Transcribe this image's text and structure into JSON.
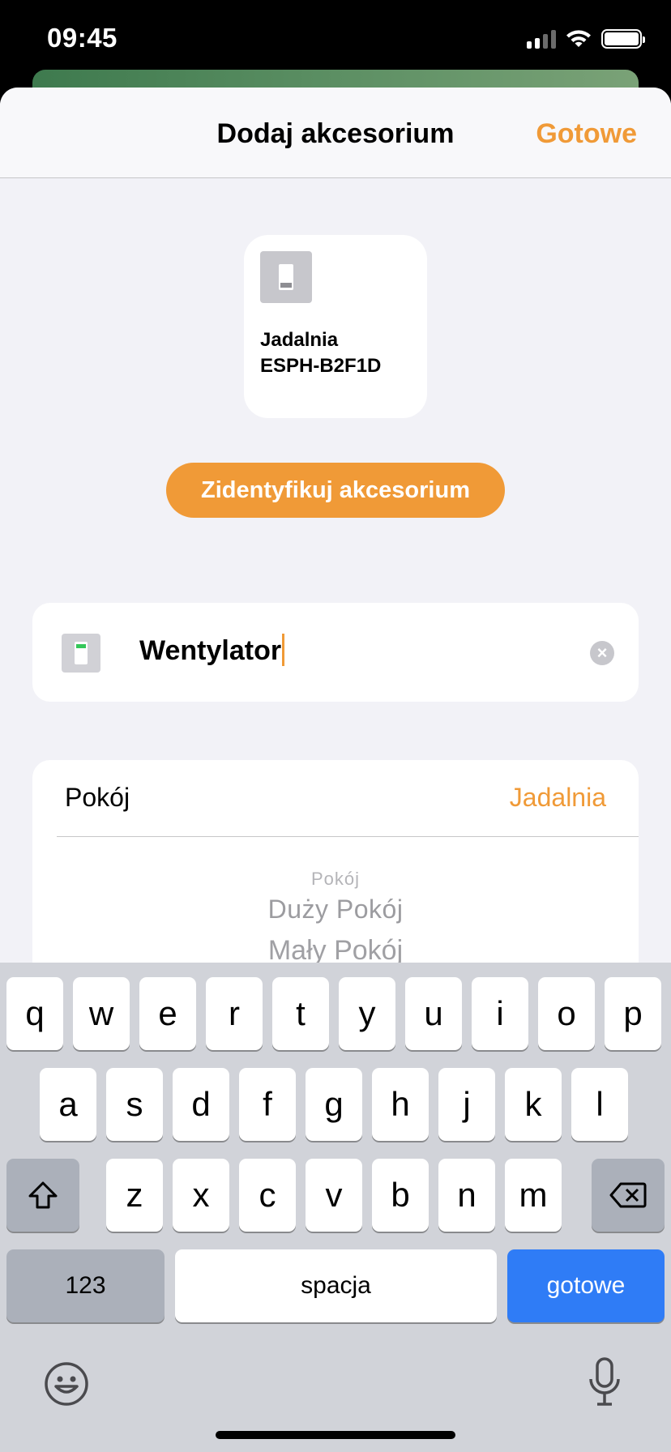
{
  "status_bar": {
    "time": "09:45"
  },
  "nav": {
    "title": "Dodaj akcesorium",
    "done": "Gotowe"
  },
  "accessory_tile": {
    "line1": "Jadalnia",
    "line2": "ESPH-B2F1D"
  },
  "identify_button": "Zidentyfikuj akcesorium",
  "name_field": {
    "value": "Wentylator"
  },
  "room": {
    "label": "Pokój",
    "value": "Jadalnia",
    "picker_options": [
      "Pokój",
      "Duży Pokój",
      "Mały Pokój"
    ]
  },
  "keyboard": {
    "row1": [
      "q",
      "w",
      "e",
      "r",
      "t",
      "y",
      "u",
      "i",
      "o",
      "p"
    ],
    "row2": [
      "a",
      "s",
      "d",
      "f",
      "g",
      "h",
      "j",
      "k",
      "l"
    ],
    "row3": [
      "z",
      "x",
      "c",
      "v",
      "b",
      "n",
      "m"
    ],
    "numbers_key": "123",
    "space_key": "spacja",
    "return_key": "gotowe"
  },
  "colors": {
    "accent": "#f09a37",
    "return_key": "#2f7cf6",
    "background": "#f2f2f7"
  }
}
